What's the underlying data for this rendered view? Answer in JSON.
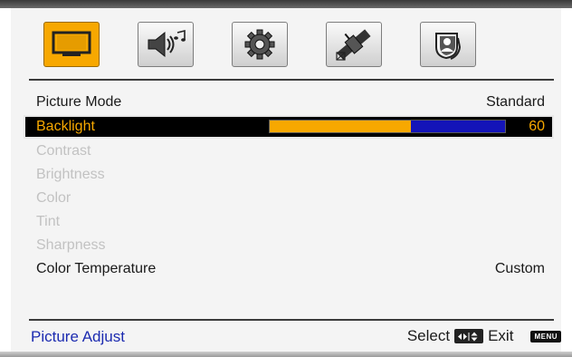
{
  "tabs": [
    {
      "icon": "tv-icon",
      "active": true
    },
    {
      "icon": "speaker-music-icon",
      "active": false
    },
    {
      "icon": "gear-icon",
      "active": false
    },
    {
      "icon": "satellite-icon",
      "active": false
    },
    {
      "icon": "parental-lock-icon",
      "active": false
    }
  ],
  "menu": {
    "items": [
      {
        "label": "Picture  Mode",
        "value": "Standard",
        "state": "normal"
      },
      {
        "label": "Backlight",
        "value": "60",
        "state": "selected",
        "level_percent": 60
      },
      {
        "label": "Contrast",
        "state": "disabled"
      },
      {
        "label": "Brightness",
        "state": "disabled"
      },
      {
        "label": "Color",
        "state": "disabled"
      },
      {
        "label": "Tint",
        "state": "disabled"
      },
      {
        "label": "Sharpness",
        "state": "disabled"
      },
      {
        "label": "Color Temperature",
        "value": "Custom",
        "state": "normal"
      }
    ]
  },
  "footer": {
    "section_title": "Picture Adjust",
    "select_label": "Select",
    "exit_label": "Exit",
    "menu_key_label": "MENU"
  },
  "colors": {
    "accent": "#f7a800",
    "bar_track": "#1414b8",
    "footer_title": "#1c2bb0",
    "disabled_text": "#c2c2c2"
  }
}
